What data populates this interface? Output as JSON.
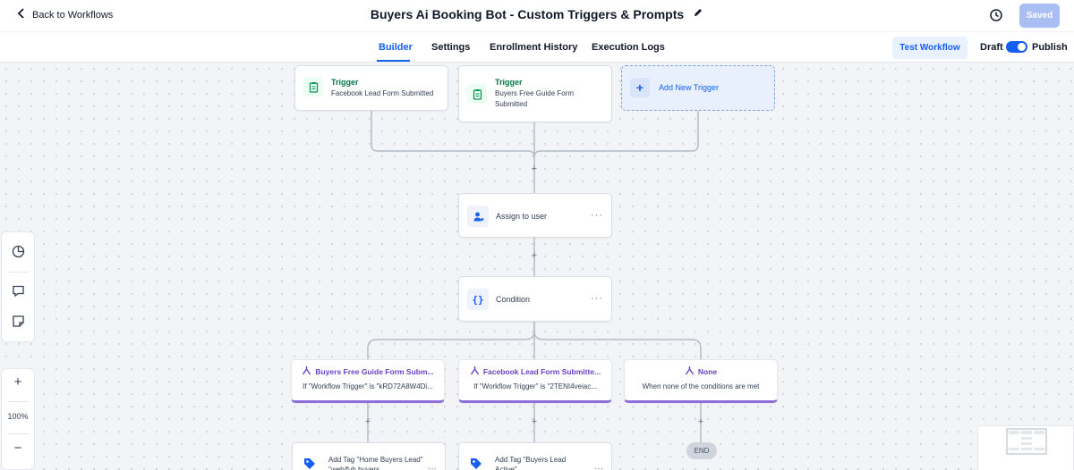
{
  "header": {
    "back_label": "Back to Workflows",
    "title": "Buyers Ai Booking Bot - Custom Triggers & Prompts",
    "saved_label": "Saved"
  },
  "tabs": [
    {
      "label": "Builder",
      "active": true
    },
    {
      "label": "Settings"
    },
    {
      "label": "Enrollment History"
    },
    {
      "label": "Execution Logs"
    }
  ],
  "toolbar": {
    "test_workflow_label": "Test Workflow",
    "draft_label": "Draft",
    "publish_label": "Publish"
  },
  "triggers": [
    {
      "title": "Trigger",
      "subtitle": "Facebook Lead Form Submitted",
      "icon": "clipboard-icon"
    },
    {
      "title": "Trigger",
      "subtitle": "Buyers Free Guide Form Submitted",
      "icon": "clipboard-icon"
    }
  ],
  "add_trigger_label": "Add New Trigger",
  "actions": {
    "assign": {
      "label": "Assign to user",
      "icon": "user-assign-icon"
    },
    "condition": {
      "label": "Condition",
      "icon": "curly-braces-icon",
      "glyph": "{}"
    }
  },
  "branches": [
    {
      "title": "Buyers Free Guide Form Subm...",
      "subtitle": "If \"Workflow Trigger\" is \"kRD72A8W4Di..."
    },
    {
      "title": "Facebook Lead Form Submitte...",
      "subtitle": "If \"Workflow Trigger\" is \"2TENI4veiac..."
    },
    {
      "title": "None",
      "subtitle": "When none of the conditions are met"
    }
  ],
  "tags": [
    {
      "label": "Add Tag \"Home Buyers Lead\" \"web/fub buyers"
    },
    {
      "label": "Add Tag \"Buyers Lead Active\""
    }
  ],
  "end_label": "END",
  "menu_glyph": "···",
  "zoom": {
    "level": "100%",
    "in_glyph": "+",
    "out_glyph": "−"
  },
  "colors": {
    "accent": "#155eef",
    "branch": "#8e6ed9",
    "trigger": "#067647"
  }
}
